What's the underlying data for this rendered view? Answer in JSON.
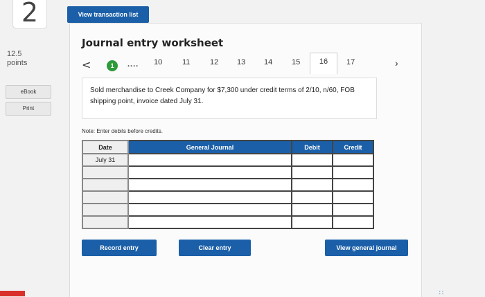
{
  "question": {
    "number": "2",
    "points_value": "12.5",
    "points_label": "points",
    "ebook_label": "eBook",
    "print_label": "Print",
    "text": "Sold merchandise to Creek Company for $7,300 under credit terms of 2/10, n/60, FOB shipping point, invoice dated July 31."
  },
  "toolbar": {
    "view_transactions_label": "View transaction list"
  },
  "worksheet": {
    "title": "Journal entry worksheet",
    "nav": {
      "current_step": "1",
      "ellipsis": "....",
      "tabs": [
        "10",
        "11",
        "12",
        "13",
        "14",
        "15",
        "16",
        "17"
      ],
      "active_tab": "16"
    },
    "note": "Note: Enter debits before credits.",
    "headers": {
      "date": "Date",
      "general_journal": "General Journal",
      "debit": "Debit",
      "credit": "Credit"
    },
    "rows": [
      {
        "date": "July 31"
      },
      {
        "date": ""
      },
      {
        "date": ""
      },
      {
        "date": ""
      },
      {
        "date": ""
      },
      {
        "date": ""
      }
    ]
  },
  "actions": {
    "record": "Record entry",
    "clear": "Clear entry",
    "view_journal": "View general journal"
  },
  "colors": {
    "accent": "#1a5fa8",
    "success": "#2e9a3a"
  }
}
